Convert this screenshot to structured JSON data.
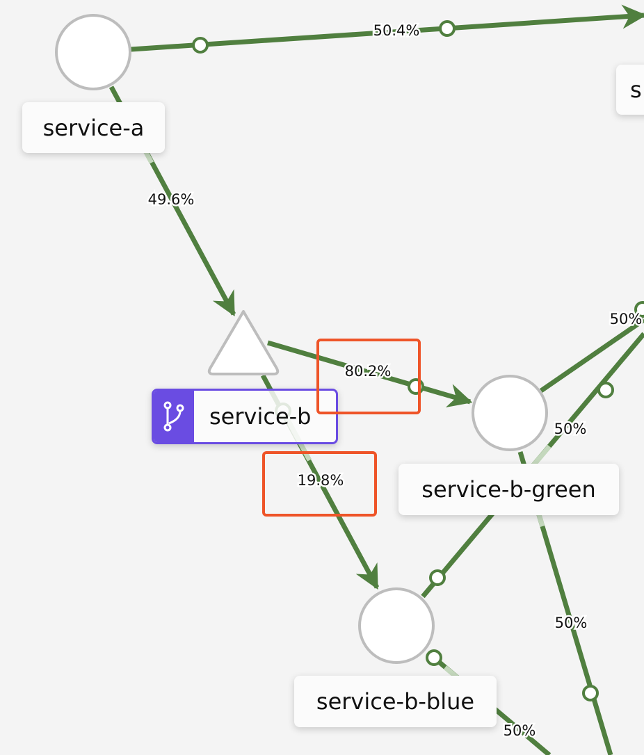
{
  "nodes": {
    "service_a": "service-a",
    "service_b": "service-b",
    "service_b_green": "service-b-green",
    "service_b_blue": "service-b-blue",
    "partial_right": "s"
  },
  "edges": {
    "a_to_right": "50.4%",
    "a_to_b": "49.6%",
    "b_to_green": "80.2%",
    "b_to_blue": "19.8%",
    "green_to_up": "50%",
    "blue_to_up": "50%",
    "green_to_down": "50%",
    "blue_to_down": "50%"
  },
  "colors": {
    "edge": "#507f3f",
    "highlight": "#ee5428",
    "branch_badge": "#6a4ce2"
  },
  "icons": {
    "service_b_badge": "branch-icon"
  }
}
